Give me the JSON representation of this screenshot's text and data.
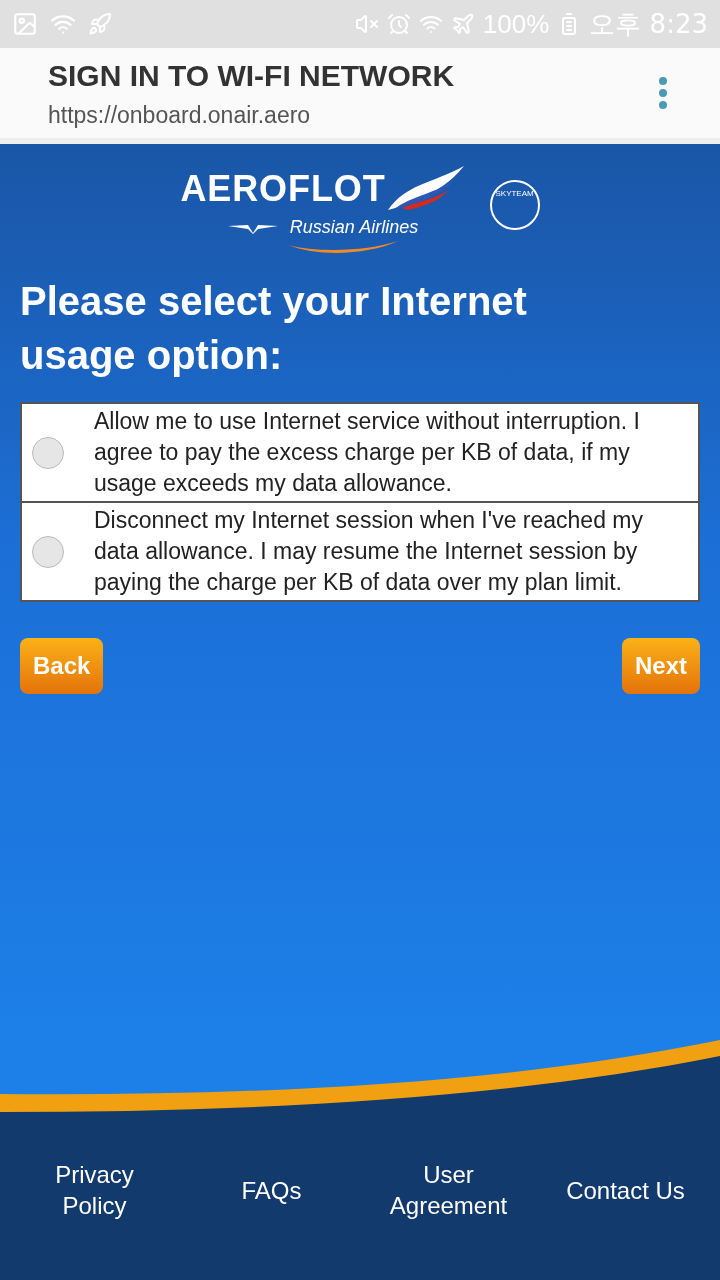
{
  "status_bar": {
    "battery": "100%",
    "time": "오후 8:23"
  },
  "header": {
    "title": "SIGN IN TO WI-FI NETWORK",
    "url": "https://onboard.onair.aero"
  },
  "logo": {
    "brand": "AEROFLOT",
    "tagline": "Russian Airlines",
    "alliance": "SKYTEAM"
  },
  "heading": "Please select your Internet usage option:",
  "options": [
    {
      "label": "Allow me to use Internet service without interruption. I agree to pay the excess charge per KB of data, if my usage exceeds my data allowance.",
      "selected": false
    },
    {
      "label": "Disconnect my Internet session when I've reached my data allowance. I may resume the Internet session by paying the charge per KB of data over my plan limit.",
      "selected": false
    }
  ],
  "buttons": {
    "back": "Back",
    "next": "Next"
  },
  "footer_links": [
    "Privacy Policy",
    "FAQs",
    "User Agreement",
    "Contact Us"
  ]
}
